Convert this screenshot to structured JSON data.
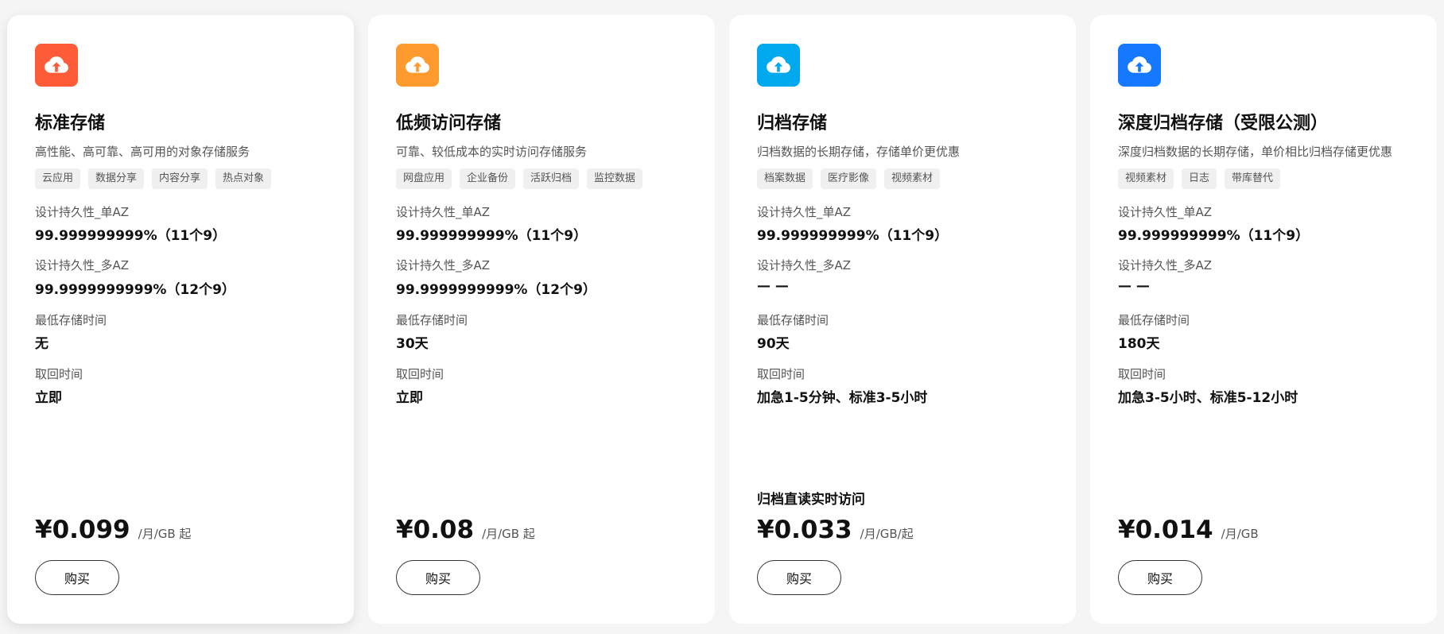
{
  "cards": [
    {
      "accent": "#fe5b38",
      "icon": "cloud-upload-icon",
      "title": "标准存储",
      "description": "高性能、高可靠、高可用的对象存储服务",
      "tags": [
        "云应用",
        "数据分享",
        "内容分享",
        "热点对象"
      ],
      "specs": [
        {
          "label": "设计持久性_单AZ",
          "value": "99.999999999%（11个9）"
        },
        {
          "label": "设计持久性_多AZ",
          "value": "99.9999999999%（12个9）"
        },
        {
          "label": "最低存储时间",
          "value": "无"
        },
        {
          "label": "取回时间",
          "value": "立即"
        }
      ],
      "extra": "",
      "price": "¥0.099",
      "unit": "/月/GB 起",
      "button": "购买"
    },
    {
      "accent": "#ff9a2e",
      "icon": "cloud-upload-icon",
      "title": "低频访问存储",
      "description": "可靠、较低成本的实时访问存储服务",
      "tags": [
        "网盘应用",
        "企业备份",
        "活跃归档",
        "监控数据"
      ],
      "specs": [
        {
          "label": "设计持久性_单AZ",
          "value": "99.999999999%（11个9）"
        },
        {
          "label": "设计持久性_多AZ",
          "value": "99.9999999999%（12个9）"
        },
        {
          "label": "最低存储时间",
          "value": "30天"
        },
        {
          "label": "取回时间",
          "value": "立即"
        }
      ],
      "extra": "",
      "price": "¥0.08",
      "unit": "/月/GB 起",
      "button": "购买"
    },
    {
      "accent": "#00a8ee",
      "icon": "cloud-upload-icon",
      "title": "归档存储",
      "description": "归档数据的长期存储，存储单价更优惠",
      "tags": [
        "档案数据",
        "医疗影像",
        "视频素材"
      ],
      "specs": [
        {
          "label": "设计持久性_单AZ",
          "value": "99.999999999%（11个9）"
        },
        {
          "label": "设计持久性_多AZ",
          "value": "— —"
        },
        {
          "label": "最低存储时间",
          "value": "90天"
        },
        {
          "label": "取回时间",
          "value": "加急1-5分钟、标准3-5小时"
        }
      ],
      "extra": "归档直读实时访问",
      "price": "¥0.033",
      "unit": "/月/GB/起",
      "button": "购买"
    },
    {
      "accent": "#1677ff",
      "icon": "cloud-upload-icon",
      "title": "深度归档存储（受限公测）",
      "description": "深度归档数据的长期存储，单价相比归档存储更优惠",
      "tags": [
        "视频素材",
        "日志",
        "带库替代"
      ],
      "specs": [
        {
          "label": "设计持久性_单AZ",
          "value": "99.999999999%（11个9）"
        },
        {
          "label": "设计持久性_多AZ",
          "value": "— —"
        },
        {
          "label": "最低存储时间",
          "value": "180天"
        },
        {
          "label": "取回时间",
          "value": "加急3-5小时、标准5-12小时"
        }
      ],
      "extra": "",
      "price": "¥0.014",
      "unit": "/月/GB",
      "button": "购买"
    }
  ]
}
